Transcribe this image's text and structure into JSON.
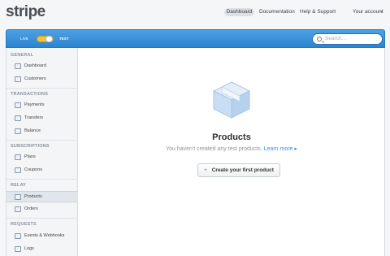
{
  "app": {
    "logo": "stripe",
    "nav": {
      "dashboard": "Dashboard",
      "documentation": "Documentation",
      "help": "Help & Support",
      "account": "Your account"
    }
  },
  "header": {
    "live_label": "LIVE",
    "test_label": "TEST",
    "search_placeholder": "Search..."
  },
  "sidebar": {
    "sections": [
      {
        "title": "GENERAL",
        "items": [
          "Dashboard",
          "Customers"
        ]
      },
      {
        "title": "TRANSACTIONS",
        "items": [
          "Payments",
          "Transfers",
          "Balance"
        ]
      },
      {
        "title": "SUBSCRIPTIONS",
        "items": [
          "Plans",
          "Coupons"
        ]
      },
      {
        "title": "RELAY",
        "items": [
          "Products",
          "Orders"
        ]
      },
      {
        "title": "REQUESTS",
        "items": [
          "Events & Webhooks",
          "Logs"
        ]
      }
    ],
    "active_item": "Products"
  },
  "main": {
    "title": "Products",
    "subtitle": "You haven't created any test products.",
    "learn_more": "Learn more ▸",
    "create_button": "Create your first product",
    "plus": "+"
  },
  "colors": {
    "accent": "#3a8ee6",
    "header_blue": "#2d84cf",
    "toggle": "#f3c33d"
  }
}
